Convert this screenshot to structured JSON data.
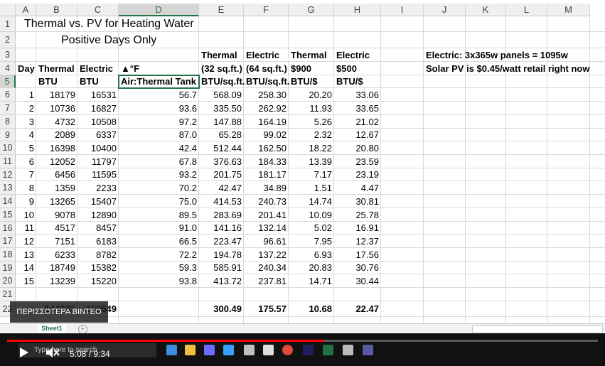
{
  "columns": [
    "A",
    "B",
    "C",
    "D",
    "E",
    "F",
    "G",
    "H",
    "I",
    "J",
    "K",
    "L",
    "M"
  ],
  "selected_column": "D",
  "selected_row": "5",
  "rows": [
    "1",
    "2",
    "3",
    "4",
    "5",
    "6",
    "7",
    "8",
    "9",
    "10",
    "11",
    "12",
    "13",
    "14",
    "15",
    "16",
    "17",
    "18",
    "19",
    "20",
    "21",
    "22"
  ],
  "title_line1": "Thermal vs. PV for Heating Water",
  "title_line2": "Positive Days Only",
  "headers": {
    "row3": {
      "E": "Thermal",
      "F": "Electric",
      "G": "Thermal",
      "H": "Electric",
      "J": "Electric: 3x365w panels = 1095w"
    },
    "row4": {
      "A": "Day",
      "B": "Thermal",
      "C": "Electric",
      "D": "▲°F",
      "E": "(32 sq.ft.)",
      "F": "(64 sq.ft.)",
      "G": "$900",
      "H": "$500",
      "J": "Solar PV is $0.45/watt retail right now"
    },
    "row5": {
      "B": "BTU",
      "C": "BTU",
      "D": "Air:Thermal Tank",
      "E": "BTU/sq.ft.",
      "F": "BTU/sq.ft.",
      "G": "BTU/$",
      "H": "BTU/$"
    }
  },
  "data_rows": [
    [
      "1",
      "18179",
      "16531",
      "56.7",
      "568.09",
      "258.30",
      "20.20",
      "33.06"
    ],
    [
      "2",
      "10736",
      "16827",
      "93.6",
      "335.50",
      "262.92",
      "11.93",
      "33.65"
    ],
    [
      "3",
      "4732",
      "10508",
      "97.2",
      "147.88",
      "164.19",
      "5.26",
      "21.02"
    ],
    [
      "4",
      "2089",
      "6337",
      "87.0",
      "65.28",
      "99.02",
      "2.32",
      "12.67"
    ],
    [
      "5",
      "16398",
      "10400",
      "42.4",
      "512.44",
      "162.50",
      "18.22",
      "20.80"
    ],
    [
      "6",
      "12052",
      "11797",
      "67.8",
      "376.63",
      "184.33",
      "13.39",
      "23.59"
    ],
    [
      "7",
      "6456",
      "11595",
      "93.2",
      "201.75",
      "181.17",
      "7.17",
      "23.19"
    ],
    [
      "8",
      "1359",
      "2233",
      "70.2",
      "42.47",
      "34.89",
      "1.51",
      "4.47"
    ],
    [
      "9",
      "13265",
      "15407",
      "75.0",
      "414.53",
      "240.73",
      "14.74",
      "30.81"
    ],
    [
      "10",
      "9078",
      "12890",
      "89.5",
      "283.69",
      "201.41",
      "10.09",
      "25.78"
    ],
    [
      "11",
      "4517",
      "8457",
      "91.0",
      "141.16",
      "132.14",
      "5.02",
      "16.91"
    ],
    [
      "12",
      "7151",
      "6183",
      "66.5",
      "223.47",
      "96.61",
      "7.95",
      "12.37"
    ],
    [
      "13",
      "6233",
      "8782",
      "72.2",
      "194.78",
      "137.22",
      "6.93",
      "17.56"
    ],
    [
      "14",
      "18749",
      "15382",
      "59.3",
      "585.91",
      "240.34",
      "20.83",
      "30.76"
    ],
    [
      "15",
      "13239",
      "15220",
      "93.8",
      "413.72",
      "237.81",
      "14.71",
      "30.44"
    ]
  ],
  "totals_row": {
    "B": "144233",
    "C": "168549",
    "E": "300.49",
    "F": "175.57",
    "G": "10.68",
    "H": "22.47"
  },
  "sheet_tab": "Sheet1",
  "add_sheet": "+",
  "overlay_label": "ΠΕΡΙΣΣΟΤΕΡΑ ΒΙΝΤΕΟ",
  "video": {
    "current": "5:08",
    "duration": "9:34",
    "time_display": "5:08 / 9:34",
    "progress": 0.537
  },
  "search_placeholder": "Type here to search",
  "colors": {
    "excel_green": "#217346",
    "progress_red": "#ff0000"
  },
  "taskbar_icons": [
    "windows-icon",
    "search-icon",
    "edge-icon",
    "file-explorer-icon",
    "store-icon",
    "app-icon",
    "app2-icon",
    "mail-icon",
    "chrome-icon",
    "terminal-icon",
    "excel-icon",
    "photos-icon",
    "obs-icon"
  ]
}
